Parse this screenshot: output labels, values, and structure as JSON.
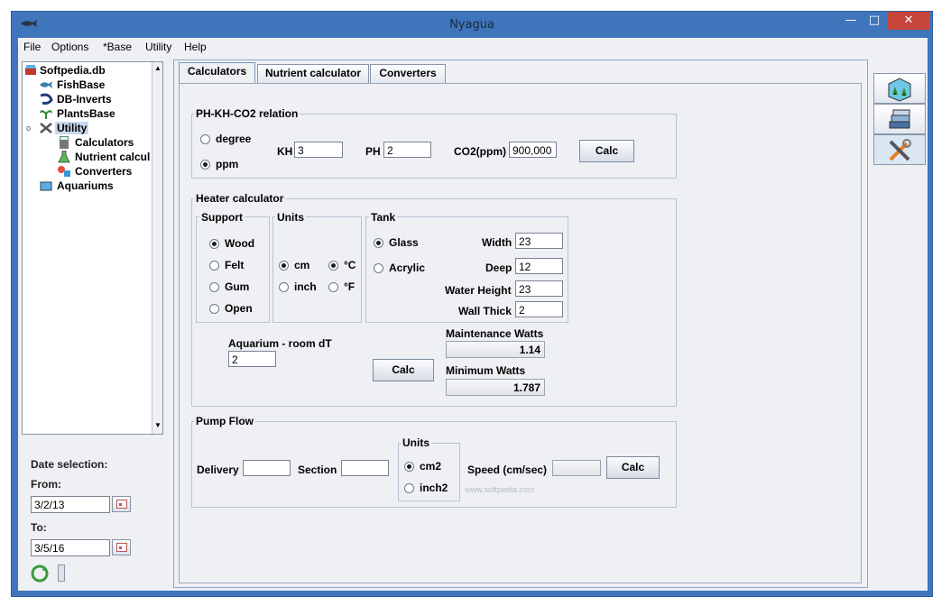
{
  "window": {
    "title": "Nyagua"
  },
  "menu": [
    "File",
    "Options",
    "*Base",
    "Utility",
    "Help"
  ],
  "tree": {
    "root": "Softpedia.db",
    "items": [
      {
        "label": "FishBase",
        "icon": "fish-icon"
      },
      {
        "label": "DB-Inverts",
        "icon": "shrimp-icon"
      },
      {
        "label": "PlantsBase",
        "icon": "plant-icon"
      },
      {
        "label": "Utility",
        "icon": "tools-icon",
        "selected": true
      },
      {
        "label": "Calculators",
        "icon": "calculator-icon"
      },
      {
        "label": "Nutrient calcul",
        "icon": "flask-icon"
      },
      {
        "label": "Converters",
        "icon": "shapes-icon"
      },
      {
        "label": "Aquariums",
        "icon": "aquarium-icon"
      }
    ]
  },
  "date": {
    "title": "Date selection:",
    "from_label": "From:",
    "from_value": "3/2/13",
    "to_label": "To:",
    "to_value": "3/5/16"
  },
  "tabs": [
    "Calculators",
    "Nutrient calculator",
    "Converters"
  ],
  "phkh": {
    "title": "PH-KH-CO2 relation",
    "degree": "degree",
    "ppm": "ppm",
    "kh_label": "KH",
    "kh_value": "3",
    "ph_label": "PH",
    "ph_value": "2",
    "co2_label": "CO2(ppm)",
    "co2_value": "900,000",
    "calc": "Calc"
  },
  "heater": {
    "title": "Heater calculator",
    "support_title": "Support",
    "support": [
      "Wood",
      "Felt",
      "Gum",
      "Open"
    ],
    "units_title": "Units",
    "cm": "cm",
    "inch": "inch",
    "celsius": "°C",
    "fahrenheit": "°F",
    "tank_title": "Tank",
    "glass": "Glass",
    "acrylic": "Acrylic",
    "width_label": "Width",
    "width_value": "23",
    "deep_label": "Deep",
    "deep_value": "12",
    "water_height_label": "Water Height",
    "water_height_value": "23",
    "wall_thick_label": "Wall Thick",
    "wall_thick_value": "2",
    "room_dt_label": "Aquarium - room dT",
    "room_dt_value": "2",
    "calc": "Calc",
    "maint_label": "Maintenance Watts",
    "maint_value": "1.14",
    "min_label": "Minimum Watts",
    "min_value": "1.787"
  },
  "pump": {
    "title": "Pump Flow",
    "delivery_label": "Delivery",
    "delivery_value": "",
    "section_label": "Section",
    "section_value": "",
    "units_title": "Units",
    "cm2": "cm2",
    "inch2": "inch2",
    "speed_label": "Speed (cm/sec)",
    "speed_value": "",
    "calc": "Calc"
  },
  "watermark": "www.softpedia.com"
}
